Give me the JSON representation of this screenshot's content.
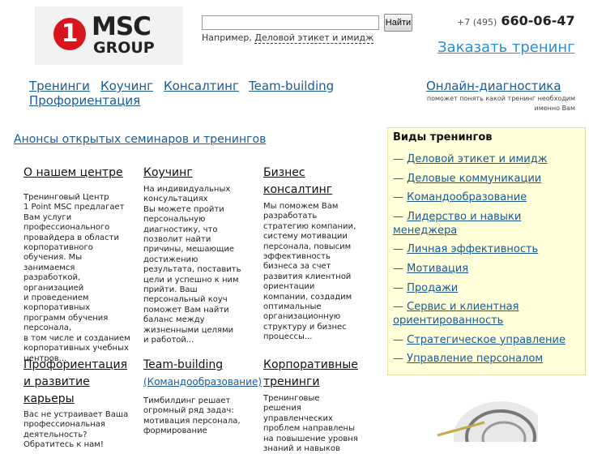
{
  "logo": {
    "digit": "1",
    "brand": "MSC",
    "group": "GROUP"
  },
  "search": {
    "value": "",
    "button": "Найти",
    "hint_prefix": "Например,",
    "hint_link": "Деловой этикет и имидж"
  },
  "contact": {
    "phone_code": "+7 (495)",
    "phone_number": "660-06-47",
    "order_link": "Заказать тренинг"
  },
  "nav": {
    "items": [
      "Тренинги",
      "Коучинг",
      "Консалтинг",
      "Team-building",
      "Профориентация"
    ],
    "diagnostics": "Онлайн-диагностика",
    "diagnostics_sub": "поможет понять какой тренинг необходим именно Вам"
  },
  "announce": "Анонсы открытых семинаров и тренингов",
  "columns": [
    {
      "title": "О нашем центре",
      "text": "Тренинговый Центр\n1 Point MSC предлагает Вам услуги профессионального провайдера в области корпоративного обучения. Мы занимаемся разработкой, организацией\nи проведением корпоративных программ обучения персонала,\nв том числе и созданием корпоративных учебных центров..."
    },
    {
      "title": "Коучинг",
      "text": "На индивидуальных консультациях\nВы можете пройти персональную диагностику, что позволит найти причины, мешающие достижению результата, поставить цели и успешно к ним прийти. Ваш персональный коуч поможет Вам найти баланс между жизненными целями\nи работой..."
    },
    {
      "title": "Бизнес консалтинг",
      "text": "Мы поможем Вам разработать стратегию компании, систему мотивации персонала, повысим эффективность бизнеса за счет развития клиентной ориентации компании, создадим оптимальные организационную структуру и бизнес процессы..."
    },
    {
      "title": "Профориентация и развитие карьеры",
      "text": "Вас не устраивает Ваша профессиональная деятельность? Обратитесь к нам!"
    },
    {
      "title": "Team-building",
      "subtitle": "(Командообразование)",
      "text": "Тимбилдинг решает огромный ряд задач: мотивация персонала, формирование"
    },
    {
      "title": "Корпоративные тренинги",
      "text": "Тренинговые решения управленческих проблем направлены на повышение уровня знаний и навыков"
    }
  ],
  "training_types": {
    "title": "Виды тренингов",
    "items": [
      "Деловой этикет и имидж",
      "Деловые коммуникации",
      "Командообразование",
      "Лидерство и навыки менеджера",
      "Личная эффективность",
      "Мотивация",
      "Продажи",
      "Сервис и клиентная ориентированность",
      "Стратегическое управление",
      "Управление персоналом"
    ]
  }
}
